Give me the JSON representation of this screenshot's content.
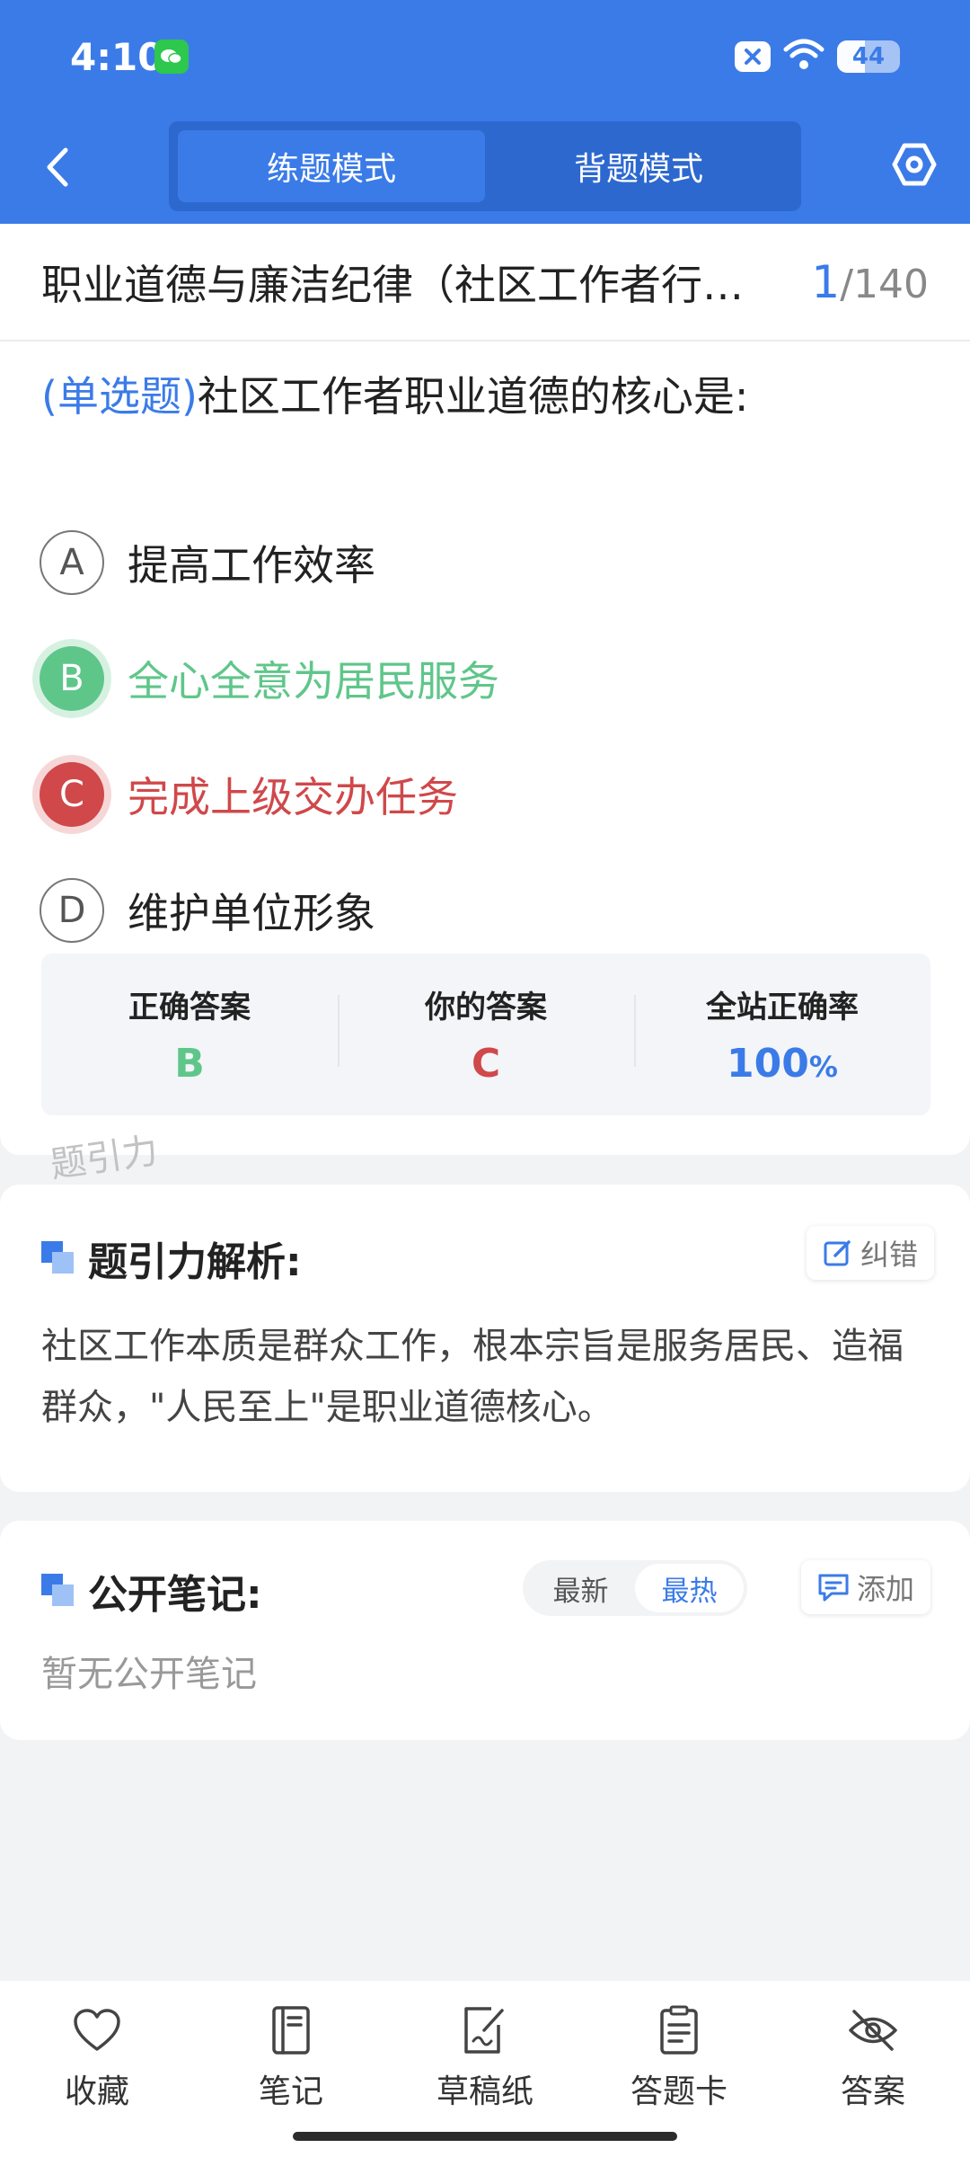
{
  "status_bar": {
    "time": "4:10",
    "battery": "44",
    "battery_fraction": 0.44
  },
  "header": {
    "modes": [
      "练题模式",
      "背题模式"
    ],
    "active_mode": "练题模式"
  },
  "question": {
    "title": "职业道德与廉洁纪律（社区工作者行…",
    "current": "1",
    "total": "/140",
    "type": "(单选题)",
    "text": "社区工作者职业道德的核心是:",
    "options": [
      {
        "letter": "A",
        "text": "提高工作效率",
        "state": "normal"
      },
      {
        "letter": "B",
        "text": "全心全意为居民服务",
        "state": "correct"
      },
      {
        "letter": "C",
        "text": "完成上级交办任务",
        "state": "wrong"
      },
      {
        "letter": "D",
        "text": "维护单位形象",
        "state": "normal"
      }
    ]
  },
  "stats": {
    "correct_label": "正确答案",
    "correct_value": "B",
    "yours_label": "你的答案",
    "yours_value": "C",
    "rate_label": "全站正确率",
    "rate_value": "100",
    "rate_unit": "%"
  },
  "watermark": "题引力",
  "analysis": {
    "title": "题引力解析:",
    "report_label": "纠错",
    "text": "社区工作本质是群众工作，根本宗旨是服务居民、造福群众，\"人民至上\"是职业道德核心。"
  },
  "notes": {
    "title": "公开笔记:",
    "sort_options": [
      "最新",
      "最热"
    ],
    "active_sort": "最热",
    "add_label": "添加",
    "empty_text": "暂无公开笔记"
  },
  "bottom_nav": [
    {
      "label": "收藏",
      "icon": "heart-icon"
    },
    {
      "label": "笔记",
      "icon": "notebook-icon"
    },
    {
      "label": "草稿纸",
      "icon": "draft-paper-icon"
    },
    {
      "label": "答题卡",
      "icon": "answer-card-icon"
    },
    {
      "label": "答案",
      "icon": "eye-off-icon"
    }
  ],
  "colors": {
    "primary": "#3b7be8",
    "correct": "#5fc68a",
    "wrong": "#d0484a"
  }
}
